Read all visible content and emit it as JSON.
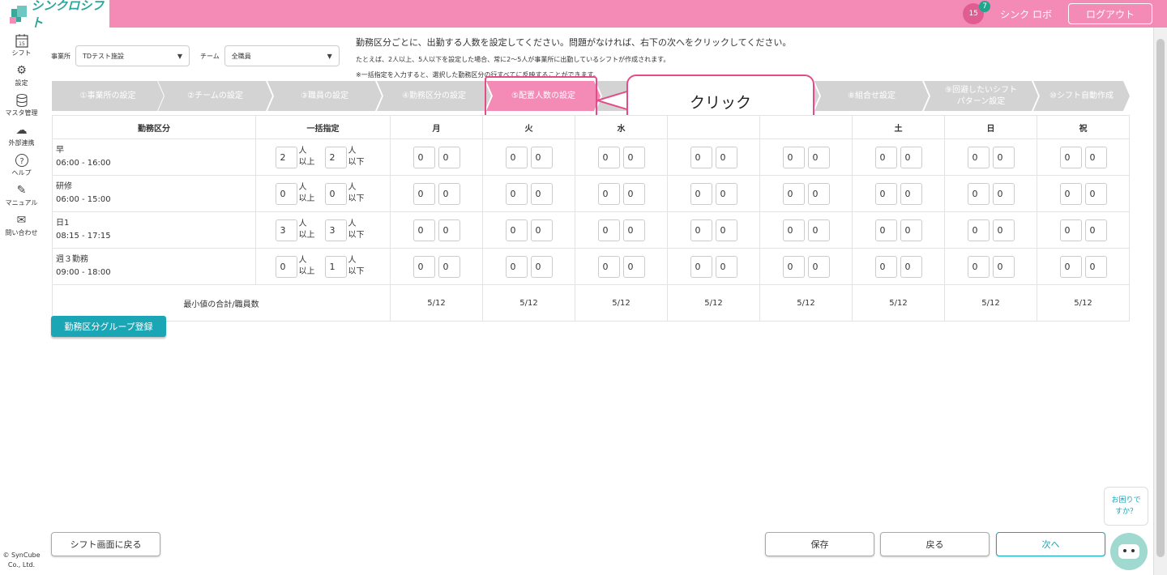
{
  "app": {
    "brand": "シンクロシフト",
    "calendar_day": "15",
    "notification_count": "7",
    "user_name": "シンク ロボ",
    "logout_label": "ログアウト"
  },
  "sidebar": {
    "items": [
      {
        "label": "シフト",
        "icon": "calendar-icon"
      },
      {
        "label": "設定",
        "icon": "gear-icon"
      },
      {
        "label": "マスタ管理",
        "icon": "database-icon"
      },
      {
        "label": "外部連携",
        "icon": "cloud-sync-icon"
      },
      {
        "label": "ヘルプ",
        "icon": "help-icon"
      },
      {
        "label": "マニュアル",
        "icon": "edit-icon"
      },
      {
        "label": "問い合わせ",
        "icon": "mail-icon"
      }
    ],
    "copyright_1": "© SynCube",
    "copyright_2": "Co., Ltd."
  },
  "filters": {
    "office_label": "事業所",
    "office_value": "TDテスト施設",
    "team_label": "チーム",
    "team_value": "全職員"
  },
  "instructions": {
    "line1": "勤務区分ごとに、出勤する人数を設定してください。問題がなければ、右下の次へをクリックしてください。",
    "line2": "たとえば、2人以上、5人以下を設定した場合、常に2〜5人が事業所に出勤しているシフトが作成されます。",
    "line3": "※一括指定を入力すると、選択した勤務区分の行すべてに反映することができます。"
  },
  "steps": [
    {
      "label": "①事業所の設定"
    },
    {
      "label": "②チームの設定"
    },
    {
      "label": "③職員の設定"
    },
    {
      "label": "④勤務区分の設定"
    },
    {
      "label": "⑤配置人数の設定"
    },
    {
      "label": "⑥"
    },
    {
      "label": "⑦"
    },
    {
      "label": "⑧組合せ設定"
    },
    {
      "label": "⑨回避したいシフト",
      "label2": "パターン設定"
    },
    {
      "label": "⑩シフト自動作成"
    }
  ],
  "callout": "クリック",
  "table": {
    "headers": {
      "shift": "勤務区分",
      "bulk": "一括指定",
      "days": [
        "月",
        "火",
        "水",
        "",
        "",
        "土",
        "日",
        "祝"
      ]
    },
    "unit_min_1": "人",
    "unit_min_2": "以上",
    "unit_max_1": "人",
    "unit_max_2": "以下",
    "rows": [
      {
        "name": "早",
        "time": "06:00 - 16:00",
        "min": "2",
        "max": "2"
      },
      {
        "name": "研修",
        "time": "06:00 - 15:00",
        "min": "0",
        "max": "0"
      },
      {
        "name": "日1",
        "time": "08:15 - 17:15",
        "min": "3",
        "max": "3"
      },
      {
        "name": "週３勤務",
        "time": "09:00 - 18:00",
        "min": "0",
        "max": "1"
      }
    ],
    "day_value": "0",
    "summary_label": "最小値の合計/職員数",
    "summary_values": [
      "5/12",
      "5/12",
      "5/12",
      "5/12",
      "5/12",
      "5/12",
      "5/12",
      "5/12"
    ]
  },
  "buttons": {
    "group_register": "勤務区分グループ登録",
    "back_to_shift": "シフト画面に戻る",
    "save": "保存",
    "back": "戻る",
    "next": "次へ"
  },
  "help": {
    "line1": "お困りで",
    "line2": "すか？"
  },
  "colors": {
    "brand_pink": "#f48bb7",
    "highlight": "#e44c88",
    "accent_teal": "#1aa6b5"
  }
}
